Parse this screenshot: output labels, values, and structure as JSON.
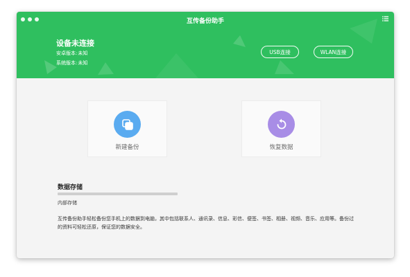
{
  "window": {
    "title": "互传备份助手"
  },
  "theme": {
    "accent": "#2fbf5f",
    "backup_circle": "#5aabf0",
    "restore_circle": "#a88de6"
  },
  "header": {
    "status": "设备未连接",
    "android_label": "安卓版本:",
    "android_value": "未知",
    "system_label": "系统版本:",
    "system_value": "未知",
    "usb_button": "USB连接",
    "wlan_button": "WLAN连接",
    "menu_icon": "list-icon"
  },
  "actions": {
    "backup": {
      "label": "新建备份",
      "icon": "copy-icon"
    },
    "restore": {
      "label": "恢复数据",
      "icon": "restore-icon"
    }
  },
  "storage": {
    "title": "数据存储",
    "subtitle": "内部存储",
    "used_fraction": 0,
    "description": "互传备份助手轻松备份您手机上的数据到电脑，其中包括联系人、通讯录、信息、彩信、便签、书签、相册、视频、音乐、应用等。备份过的资料可轻松还原，保证您的数据安全。"
  }
}
